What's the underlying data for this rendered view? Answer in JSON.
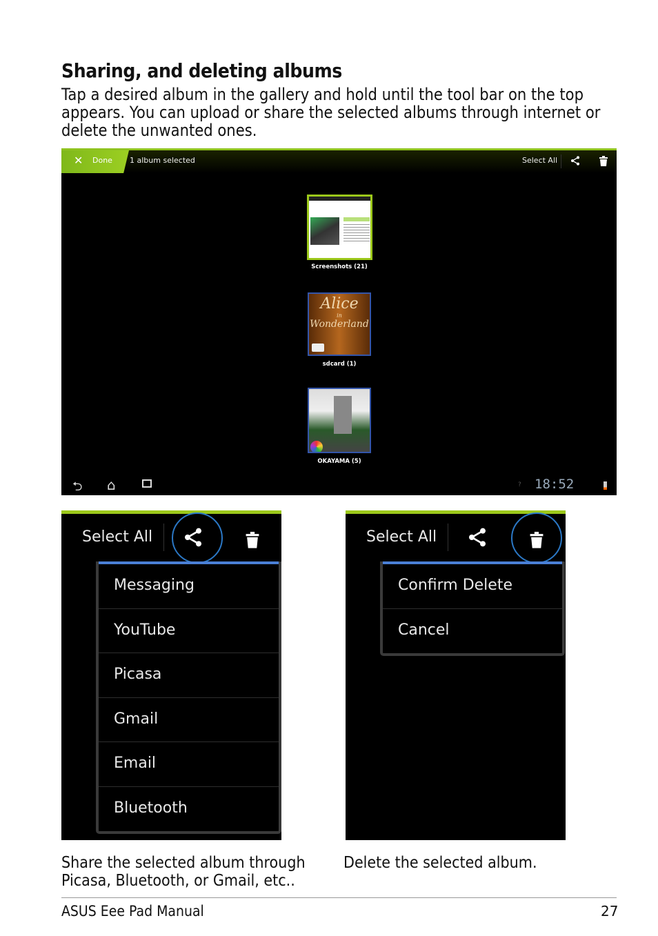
{
  "heading": "Sharing, and deleting albums",
  "intro": "Tap a desired album in the gallery and hold until the tool bar on the top appears. You can upload or share the selected albums through internet or delete the unwanted ones.",
  "screen": {
    "done_label": "Done",
    "selection_status": "1 album selected",
    "select_all": "Select All",
    "albums": [
      {
        "name": "Screenshots (21)",
        "selected": true
      },
      {
        "name": "sdcard (1)",
        "cover_text": [
          "Alice",
          "in",
          "Wonderland"
        ]
      },
      {
        "name": "OKAYAMA (5)"
      }
    ],
    "clock": "18:52"
  },
  "share_panel": {
    "select_all": "Select All",
    "menu": [
      "Messaging",
      "YouTube",
      "Picasa",
      "Gmail",
      "Email",
      "Bluetooth"
    ],
    "caption": "Share the selected album through Picasa, Bluetooth, or Gmail, etc.."
  },
  "delete_panel": {
    "select_all": "Select All",
    "menu": [
      "Confirm Delete",
      "Cancel"
    ],
    "caption": "Delete the selected album."
  },
  "footer": {
    "title": "ASUS Eee Pad Manual",
    "page": "27"
  },
  "colors": {
    "accent_green": "#8fc31f",
    "highlight_blue": "#2b78c6"
  }
}
